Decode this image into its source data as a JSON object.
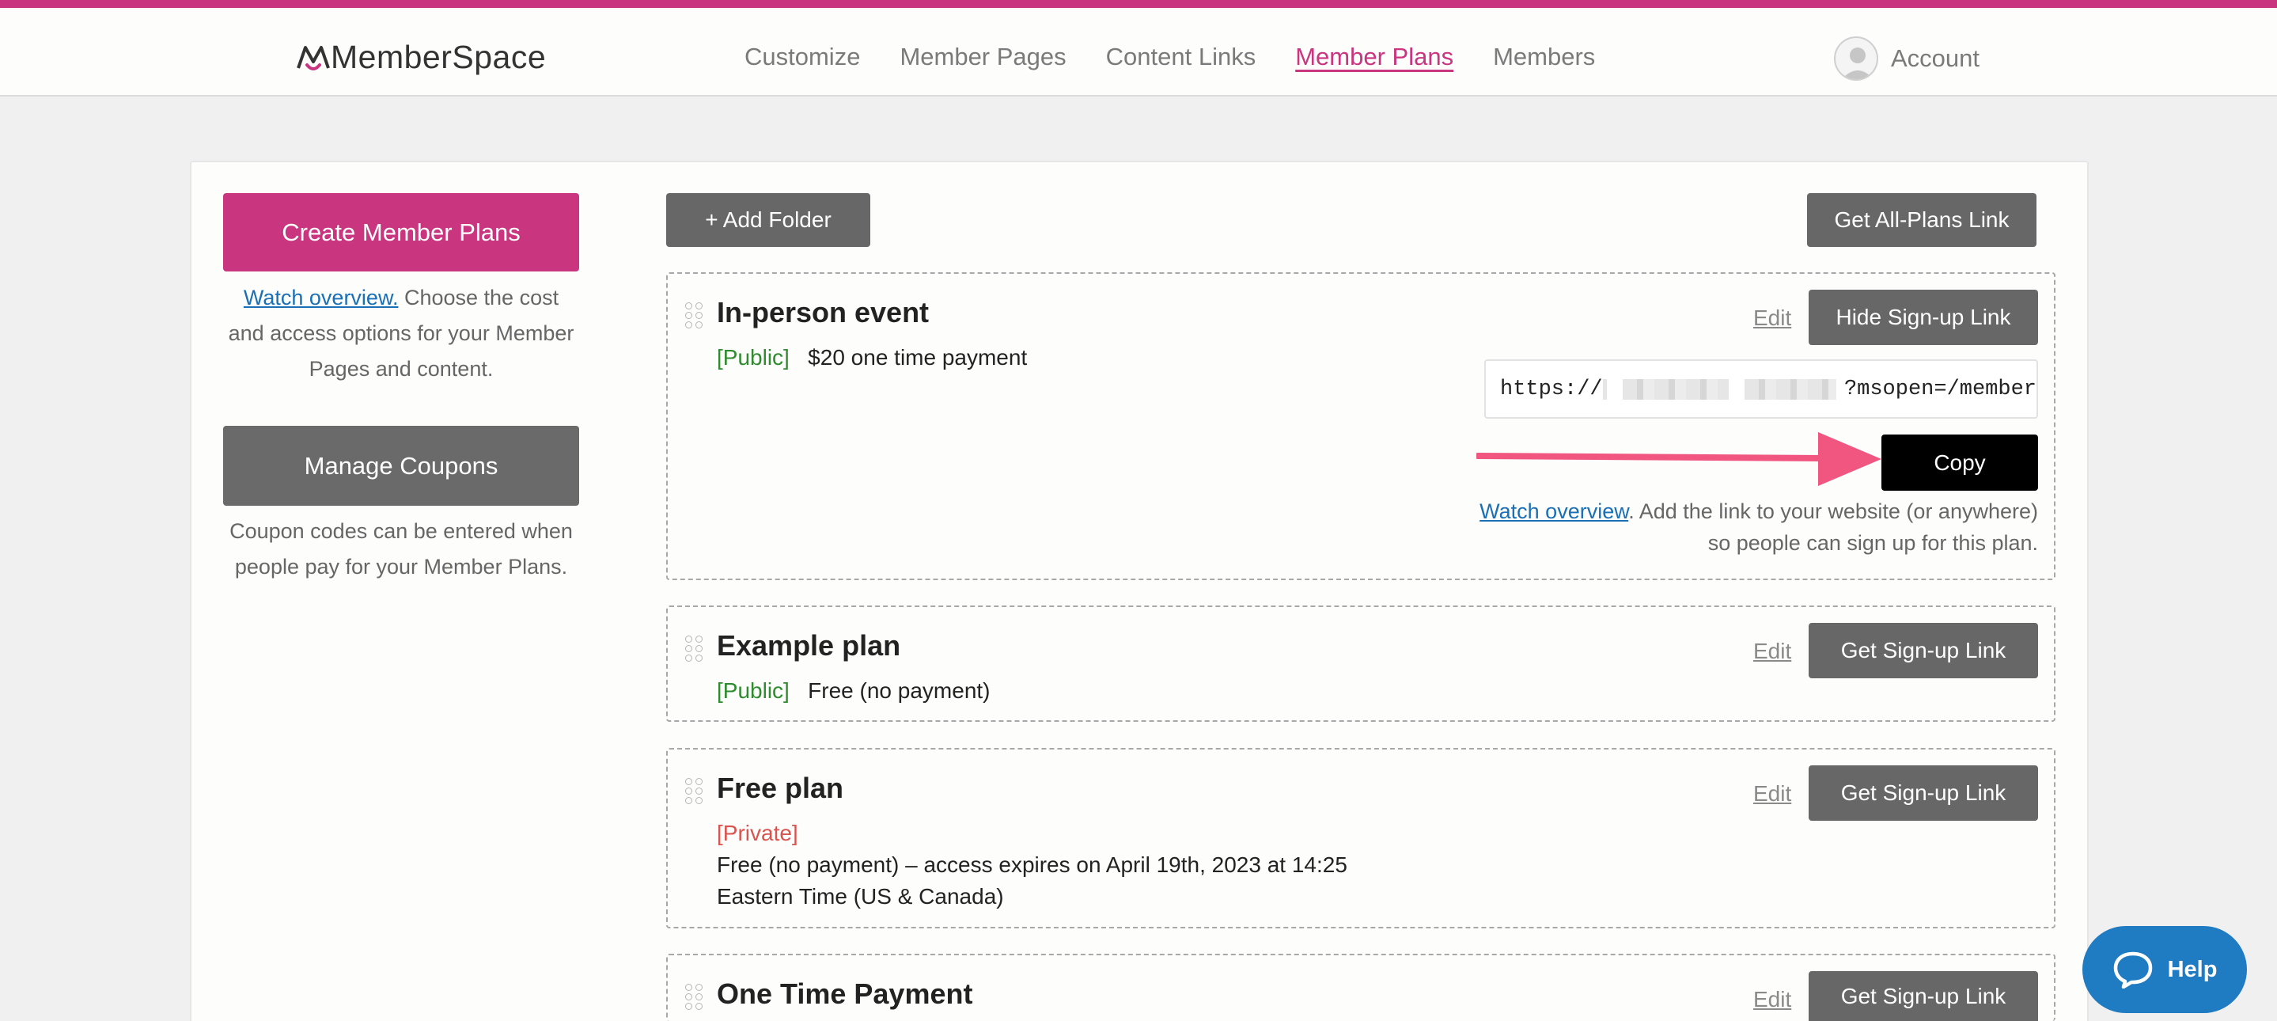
{
  "brand": {
    "name": "MemberSpace",
    "accent_color": "#c9357f"
  },
  "nav": {
    "items": [
      {
        "label": "Customize",
        "active": false
      },
      {
        "label": "Member Pages",
        "active": false
      },
      {
        "label": "Content Links",
        "active": false
      },
      {
        "label": "Member Plans",
        "active": true
      },
      {
        "label": "Members",
        "active": false
      }
    ],
    "account_label": "Account",
    "avatar_icon": "user-avatar-icon"
  },
  "sidebar": {
    "create_button": "Create Member Plans",
    "create_link": "Watch overview.",
    "create_desc": " Choose the cost and access options for your Member Pages and content.",
    "coupons_button": "Manage Coupons",
    "coupons_desc": "Coupon codes can be entered when people pay for your Member Plans."
  },
  "toolbar": {
    "add_folder": "+ Add Folder",
    "all_plans_link": "Get All-Plans Link"
  },
  "plans": [
    {
      "title": "In-person event",
      "visibility": "[Public]",
      "price": "$20 one time payment",
      "edit": "Edit",
      "action": "Hide Sign-up Link",
      "signup_url_start": "https://",
      "signup_url_end": "?msopen=/member",
      "copy_button": "Copy",
      "copy_link": "Watch overview",
      "copy_desc": ". Add the link to your website (or anywhere) so people can sign up for this plan."
    },
    {
      "title": "Example plan",
      "visibility": "[Public]",
      "price": "Free (no payment)",
      "edit": "Edit",
      "action": "Get Sign-up Link"
    },
    {
      "title": "Free plan",
      "visibility": "[Private]",
      "price_line1": "Free (no payment) – access expires on April 19th, 2023 at 14:25",
      "price_line2": "Eastern Time (US & Canada)",
      "edit": "Edit",
      "action": "Get Sign-up Link"
    },
    {
      "title": "One Time Payment",
      "edit": "Edit",
      "action": "Get Sign-up Link"
    }
  ],
  "help": {
    "label": "Help",
    "icon": "chat-bubble-icon"
  }
}
